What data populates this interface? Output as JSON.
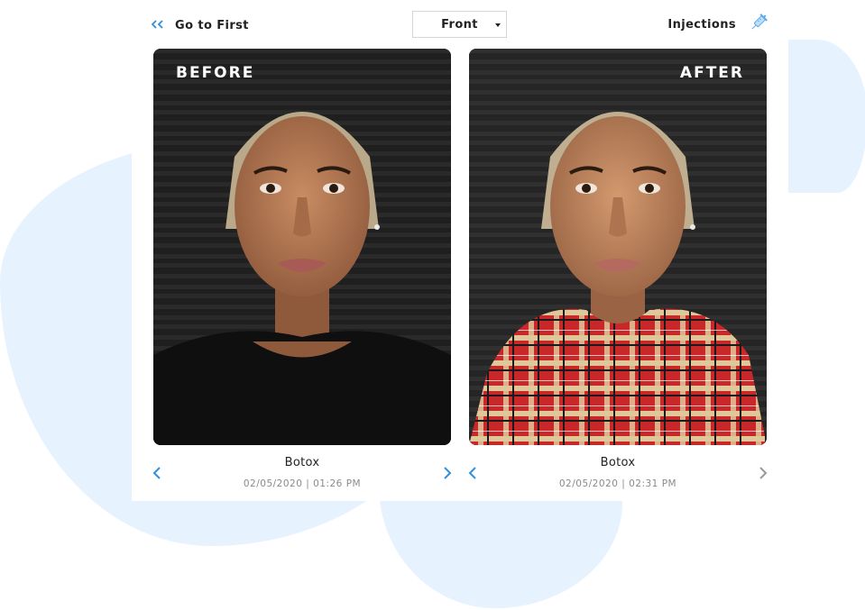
{
  "toolbar": {
    "go_first_label": "Go to First",
    "go_first_icon": "double-chevron-left-icon",
    "view_select": {
      "value": "Front"
    },
    "injections_label": "Injections",
    "injections_icon": "syringe-icon"
  },
  "photos": {
    "before": {
      "tag": "BEFORE",
      "treatment": "Botox",
      "timestamp": "02/05/2020 | 01:26 PM"
    },
    "after": {
      "tag": "AFTER",
      "treatment": "Botox",
      "timestamp": "02/05/2020 | 02:31 PM"
    }
  },
  "colors": {
    "accent": "#2f8fe0",
    "background_blob": "#e6f2fd",
    "muted_text": "#8a8a8a",
    "disabled_arrow": "#9a9a9a"
  }
}
